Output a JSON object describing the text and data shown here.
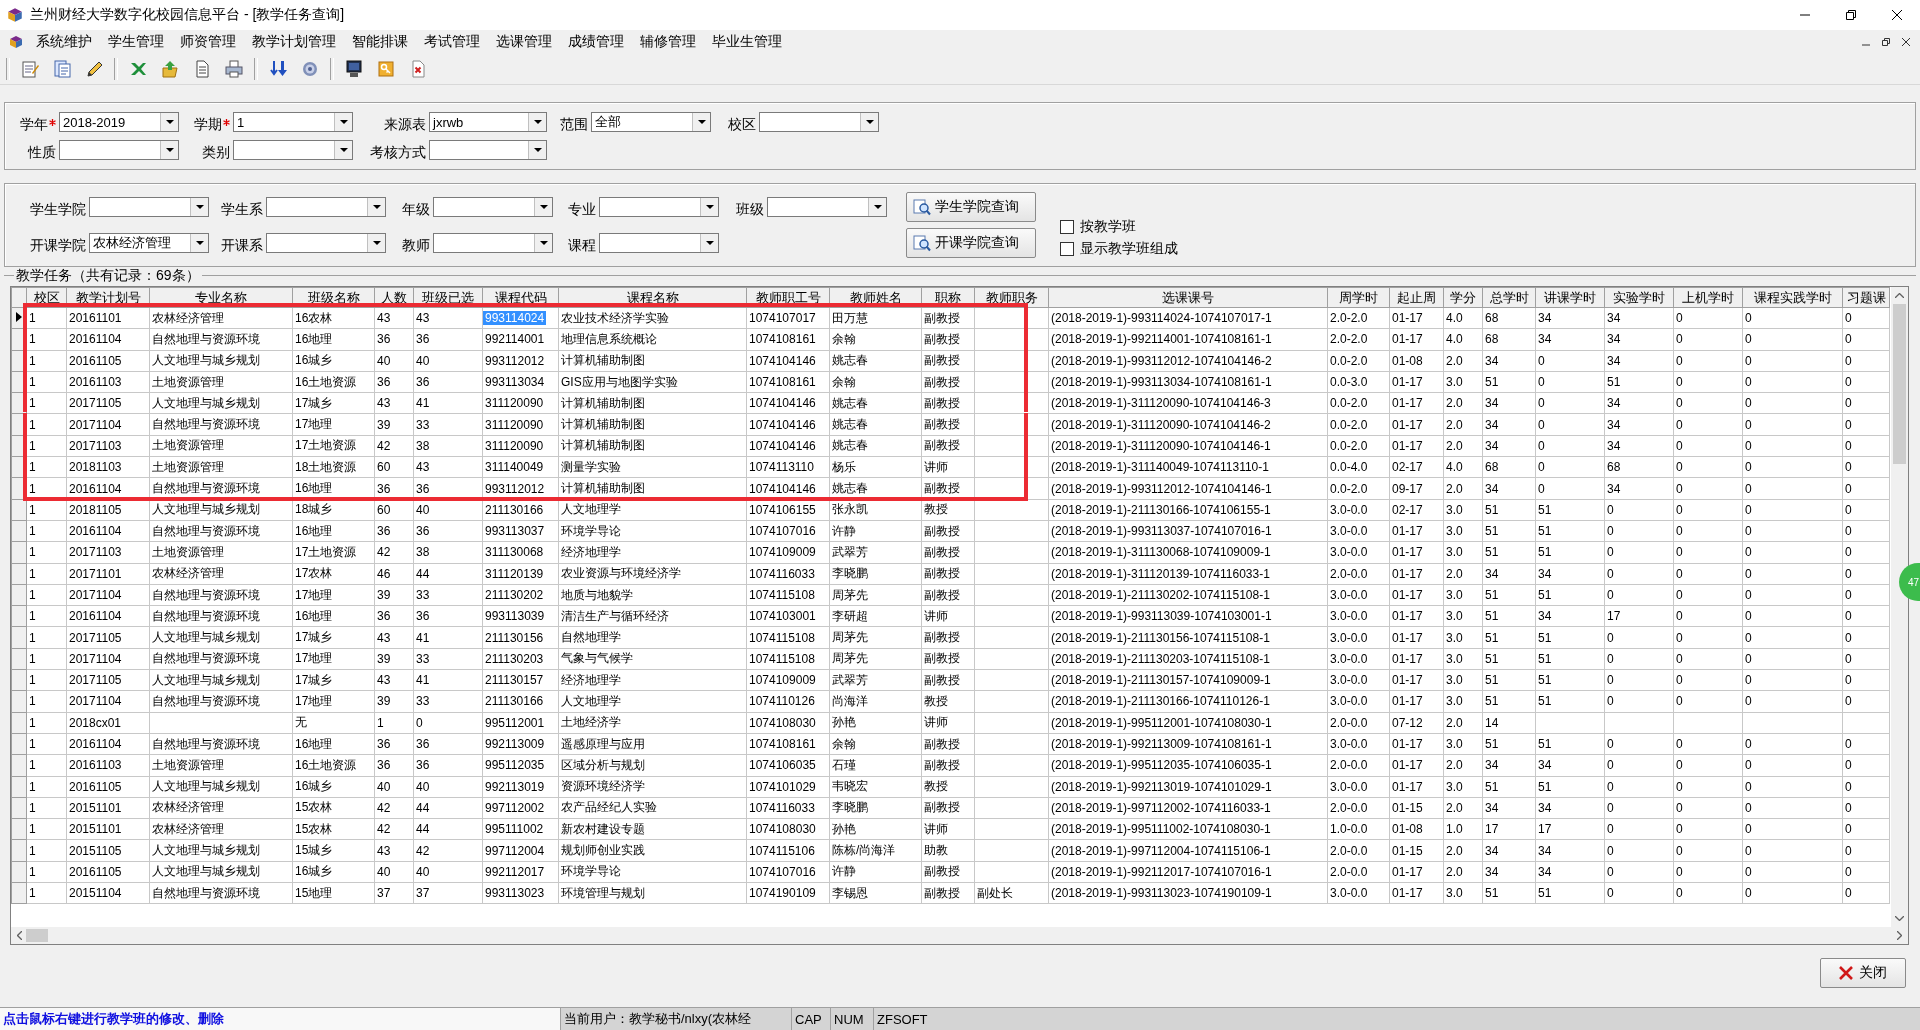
{
  "window": {
    "title": "兰州财经大学数字化校园信息平台 - [教学任务查询]"
  },
  "menu": [
    "系统维护",
    "学生管理",
    "师资管理",
    "教学计划管理",
    "智能排课",
    "考试管理",
    "选课管理",
    "成绩管理",
    "辅修管理",
    "毕业生管理"
  ],
  "query_panel": {
    "rows": [
      [
        {
          "label": "学年",
          "required": true,
          "value": "2018-2019"
        },
        {
          "label": "学期",
          "required": true,
          "value": "1"
        },
        {
          "label": "来源表",
          "required": false,
          "value": "jxrwb"
        },
        {
          "label": "范围",
          "required": false,
          "value": "全部"
        },
        {
          "label": "校区",
          "required": false
        }
      ],
      [
        {
          "label": "性质",
          "required": false
        },
        {
          "label": "类别",
          "required": false
        },
        {
          "label": "考核方式",
          "required": false
        }
      ]
    ]
  },
  "class_panel": {
    "rows": [
      {
        "fields": [
          {
            "label": "学生学院"
          },
          {
            "label": "学生系"
          },
          {
            "label": "年级"
          },
          {
            "label": "专业"
          },
          {
            "label": "班级"
          }
        ],
        "button": "学生学院查询"
      },
      {
        "fields": [
          {
            "label": "开课学院",
            "value": "农林经济管理"
          },
          {
            "label": "开课系"
          },
          {
            "label": "教师"
          },
          {
            "label": "课程"
          }
        ],
        "button": "开课学院查询"
      }
    ],
    "checkboxes": [
      {
        "label": "按教学班",
        "checked": false
      },
      {
        "label": "显示教学班组成",
        "checked": false
      }
    ]
  },
  "table": {
    "caption": "教学任务（共有记录：69条）",
    "columns": [
      {
        "label": "校区",
        "focused": false
      },
      {
        "label": "教学计划号",
        "focused": false
      },
      {
        "label": "专业名称",
        "focused": false
      },
      {
        "label": "班级名称",
        "focused": false
      },
      {
        "label": "人数",
        "focused": false
      },
      {
        "label": "班级已选",
        "focused": false
      },
      {
        "label": "课程代码",
        "focused": true
      },
      {
        "label": "课程名称",
        "focused": false
      },
      {
        "label": "教师职工号",
        "focused": false
      },
      {
        "label": "教师姓名",
        "focused": false
      },
      {
        "label": "职称",
        "focused": false
      },
      {
        "label": "教师职务",
        "focused": false
      },
      {
        "label": "选课课号",
        "focused": false
      },
      {
        "label": "周学时",
        "focused": false
      },
      {
        "label": "起止周",
        "focused": false
      },
      {
        "label": "学分",
        "focused": false
      },
      {
        "label": "总学时",
        "focused": false
      },
      {
        "label": "讲课学时",
        "focused": false
      },
      {
        "label": "实验学时",
        "focused": false
      },
      {
        "label": "上机学时",
        "focused": false
      },
      {
        "label": "课程实践学时",
        "focused": false
      },
      {
        "label": "习题课",
        "focused": false
      }
    ],
    "rows": [
      {
        "current": true,
        "marked": true,
        "cells": [
          "1",
          "20161101",
          "农林经济管理",
          "16农林",
          "43",
          "43",
          "993114024",
          "农业技术经济学实验",
          "1074107017",
          "田万慧",
          "副教授",
          null,
          "(2018-2019-1)-993114024-1074107017-1",
          "2.0-2.0",
          "01-17",
          "4.0",
          "68",
          "34",
          "34",
          "0",
          "0",
          "0"
        ]
      },
      {
        "current": false,
        "marked": true,
        "cells": [
          "1",
          "20161104",
          "自然地理与资源环境",
          "16地理",
          "36",
          "36",
          "992114001",
          "地理信息系统概论",
          "1074108161",
          "余翰",
          "副教授",
          null,
          "(2018-2019-1)-992114001-1074108161-1",
          "2.0-2.0",
          "01-17",
          "4.0",
          "68",
          "34",
          "34",
          "0",
          "0",
          "0"
        ]
      },
      {
        "current": false,
        "marked": true,
        "cells": [
          "1",
          "20161105",
          "人文地理与城乡规划",
          "16城乡",
          "40",
          "40",
          "993112012",
          "计算机辅助制图",
          "1074104146",
          "姚志春",
          "副教授",
          null,
          "(2018-2019-1)-993112012-1074104146-2",
          "0.0-2.0",
          "01-08",
          "2.0",
          "34",
          "0",
          "34",
          "0",
          "0",
          "0"
        ]
      },
      {
        "current": false,
        "marked": true,
        "cells": [
          "1",
          "20161103",
          "土地资源管理",
          "16土地资源",
          "36",
          "36",
          "993113034",
          "GIS应用与地图学实验",
          "1074108161",
          "余翰",
          "副教授",
          null,
          "(2018-2019-1)-993113034-1074108161-1",
          "0.0-3.0",
          "01-17",
          "3.0",
          "51",
          "0",
          "51",
          "0",
          "0",
          "0"
        ]
      },
      {
        "current": false,
        "marked": true,
        "cells": [
          "1",
          "20171105",
          "人文地理与城乡规划",
          "17城乡",
          "43",
          "41",
          "311120090",
          "计算机辅助制图",
          "1074104146",
          "姚志春",
          "副教授",
          null,
          "(2018-2019-1)-311120090-1074104146-3",
          "0.0-2.0",
          "01-17",
          "2.0",
          "34",
          "0",
          "34",
          "0",
          "0",
          "0"
        ]
      },
      {
        "current": false,
        "marked": true,
        "cells": [
          "1",
          "20171104",
          "自然地理与资源环境",
          "17地理",
          "39",
          "33",
          "311120090",
          "计算机辅助制图",
          "1074104146",
          "姚志春",
          "副教授",
          null,
          "(2018-2019-1)-311120090-1074104146-2",
          "0.0-2.0",
          "01-17",
          "2.0",
          "34",
          "0",
          "34",
          "0",
          "0",
          "0"
        ]
      },
      {
        "current": false,
        "marked": true,
        "cells": [
          "1",
          "20171103",
          "土地资源管理",
          "17土地资源",
          "42",
          "38",
          "311120090",
          "计算机辅助制图",
          "1074104146",
          "姚志春",
          "副教授",
          null,
          "(2018-2019-1)-311120090-1074104146-1",
          "0.0-2.0",
          "01-17",
          "2.0",
          "34",
          "0",
          "34",
          "0",
          "0",
          "0"
        ]
      },
      {
        "current": false,
        "marked": true,
        "cells": [
          "1",
          "20181103",
          "土地资源管理",
          "18土地资源",
          "60",
          "43",
          "311140049",
          "测量学实验",
          "1074113110",
          "杨乐",
          "讲师",
          null,
          "(2018-2019-1)-311140049-1074113110-1",
          "0.0-4.0",
          "02-17",
          "4.0",
          "68",
          "0",
          "68",
          "0",
          "0",
          "0"
        ]
      },
      {
        "current": false,
        "marked": true,
        "cells": [
          "1",
          "20161104",
          "自然地理与资源环境",
          "16地理",
          "36",
          "36",
          "993112012",
          "计算机辅助制图",
          "1074104146",
          "姚志春",
          "副教授",
          null,
          "(2018-2019-1)-993112012-1074104146-1",
          "0.0-2.0",
          "09-17",
          "2.0",
          "34",
          "0",
          "34",
          "0",
          "0",
          "0"
        ]
      },
      {
        "current": false,
        "marked": false,
        "cells": [
          "1",
          "20181105",
          "人文地理与城乡规划",
          "18城乡",
          "60",
          "40",
          "211130166",
          "人文地理学",
          "1074106155",
          "张永凯",
          "教授",
          null,
          "(2018-2019-1)-211130166-1074106155-1",
          "3.0-0.0",
          "02-17",
          "3.0",
          "51",
          "51",
          "0",
          "0",
          "0",
          "0"
        ]
      },
      {
        "current": false,
        "marked": false,
        "cells": [
          "1",
          "20161104",
          "自然地理与资源环境",
          "16地理",
          "36",
          "36",
          "993113037",
          "环境学导论",
          "1074107016",
          "许静",
          "副教授",
          null,
          "(2018-2019-1)-993113037-1074107016-1",
          "3.0-0.0",
          "01-17",
          "3.0",
          "51",
          "51",
          "0",
          "0",
          "0",
          "0"
        ]
      },
      {
        "current": false,
        "marked": false,
        "cells": [
          "1",
          "20171103",
          "土地资源管理",
          "17土地资源",
          "42",
          "38",
          "311130068",
          "经济地理学",
          "1074109009",
          "武翠芳",
          "副教授",
          null,
          "(2018-2019-1)-311130068-1074109009-1",
          "3.0-0.0",
          "01-17",
          "3.0",
          "51",
          "51",
          "0",
          "0",
          "0",
          "0"
        ]
      },
      {
        "current": false,
        "marked": false,
        "cells": [
          "1",
          "20171101",
          "农林经济管理",
          "17农林",
          "46",
          "44",
          "311120139",
          "农业资源与环境经济学",
          "1074116033",
          "李晓鹏",
          "副教授",
          null,
          "(2018-2019-1)-311120139-1074116033-1",
          "2.0-0.0",
          "01-17",
          "2.0",
          "34",
          "34",
          "0",
          "0",
          "0",
          "0"
        ]
      },
      {
        "current": false,
        "marked": false,
        "cells": [
          "1",
          "20171104",
          "自然地理与资源环境",
          "17地理",
          "39",
          "33",
          "211130202",
          "地质与地貌学",
          "1074115108",
          "周茅先",
          "副教授",
          null,
          "(2018-2019-1)-211130202-1074115108-1",
          "3.0-0.0",
          "01-17",
          "3.0",
          "51",
          "51",
          "0",
          "0",
          "0",
          "0"
        ]
      },
      {
        "current": false,
        "marked": false,
        "cells": [
          "1",
          "20161104",
          "自然地理与资源环境",
          "16地理",
          "36",
          "36",
          "993113039",
          "清洁生产与循环经济",
          "1074103001",
          "李研超",
          "讲师",
          null,
          "(2018-2019-1)-993113039-1074103001-1",
          "3.0-0.0",
          "01-17",
          "3.0",
          "51",
          "34",
          "17",
          "0",
          "0",
          "0"
        ]
      },
      {
        "current": false,
        "marked": false,
        "cells": [
          "1",
          "20171105",
          "人文地理与城乡规划",
          "17城乡",
          "43",
          "41",
          "211130156",
          "自然地理学",
          "1074115108",
          "周茅先",
          "副教授",
          null,
          "(2018-2019-1)-211130156-1074115108-1",
          "3.0-0.0",
          "01-17",
          "3.0",
          "51",
          "51",
          "0",
          "0",
          "0",
          "0"
        ]
      },
      {
        "current": false,
        "marked": false,
        "cells": [
          "1",
          "20171104",
          "自然地理与资源环境",
          "17地理",
          "39",
          "33",
          "211130203",
          "气象与气候学",
          "1074115108",
          "周茅先",
          "副教授",
          null,
          "(2018-2019-1)-211130203-1074115108-1",
          "3.0-0.0",
          "01-17",
          "3.0",
          "51",
          "51",
          "0",
          "0",
          "0",
          "0"
        ]
      },
      {
        "current": false,
        "marked": false,
        "cells": [
          "1",
          "20171105",
          "人文地理与城乡规划",
          "17城乡",
          "43",
          "41",
          "211130157",
          "经济地理学",
          "1074109009",
          "武翠芳",
          "副教授",
          null,
          "(2018-2019-1)-211130157-1074109009-1",
          "3.0-0.0",
          "01-17",
          "3.0",
          "51",
          "51",
          "0",
          "0",
          "0",
          "0"
        ]
      },
      {
        "current": false,
        "marked": false,
        "cells": [
          "1",
          "20171104",
          "自然地理与资源环境",
          "17地理",
          "39",
          "33",
          "211130166",
          "人文地理学",
          "1074110126",
          "尚海洋",
          "教授",
          null,
          "(2018-2019-1)-211130166-1074110126-1",
          "3.0-0.0",
          "01-17",
          "3.0",
          "51",
          "51",
          "0",
          "0",
          "0",
          "0"
        ]
      },
      {
        "current": false,
        "marked": false,
        "cells": [
          "1",
          "2018cx01",
          null,
          "无",
          "1",
          "0",
          "995112001",
          "土地经济学",
          "1074108030",
          "孙艳",
          "讲师",
          null,
          "(2018-2019-1)-995112001-1074108030-1",
          "2.0-0.0",
          "07-12",
          "2.0",
          "14",
          null,
          null,
          null,
          null,
          null
        ]
      },
      {
        "current": false,
        "marked": false,
        "cells": [
          "1",
          "20161104",
          "自然地理与资源环境",
          "16地理",
          "36",
          "36",
          "992113009",
          "遥感原理与应用",
          "1074108161",
          "余翰",
          "副教授",
          null,
          "(2018-2019-1)-992113009-1074108161-1",
          "3.0-0.0",
          "01-17",
          "3.0",
          "51",
          "51",
          "0",
          "0",
          "0",
          "0"
        ]
      },
      {
        "current": false,
        "marked": false,
        "cells": [
          "1",
          "20161103",
          "土地资源管理",
          "16土地资源",
          "36",
          "36",
          "995112035",
          "区域分析与规划",
          "1074106035",
          "石瑾",
          "副教授",
          null,
          "(2018-2019-1)-995112035-1074106035-1",
          "2.0-0.0",
          "01-17",
          "2.0",
          "34",
          "34",
          "0",
          "0",
          "0",
          "0"
        ]
      },
      {
        "current": false,
        "marked": false,
        "cells": [
          "1",
          "20161105",
          "人文地理与城乡规划",
          "16城乡",
          "40",
          "40",
          "992113019",
          "资源环境经济学",
          "1074101029",
          "韦晓宏",
          "教授",
          null,
          "(2018-2019-1)-992113019-1074101029-1",
          "3.0-0.0",
          "01-17",
          "3.0",
          "51",
          "51",
          "0",
          "0",
          "0",
          "0"
        ]
      },
      {
        "current": false,
        "marked": false,
        "cells": [
          "1",
          "20151101",
          "农林经济管理",
          "15农林",
          "42",
          "44",
          "997112002",
          "农产品经纪人实验",
          "1074116033",
          "李晓鹏",
          "副教授",
          null,
          "(2018-2019-1)-997112002-1074116033-1",
          "2.0-0.0",
          "01-15",
          "2.0",
          "34",
          "34",
          "0",
          "0",
          "0",
          "0"
        ]
      },
      {
        "current": false,
        "marked": false,
        "cells": [
          "1",
          "20151101",
          "农林经济管理",
          "15农林",
          "42",
          "44",
          "995111002",
          "新农村建设专题",
          "1074108030",
          "孙艳",
          "讲师",
          null,
          "(2018-2019-1)-995111002-1074108030-1",
          "1.0-0.0",
          "01-08",
          "1.0",
          "17",
          "17",
          "0",
          "0",
          "0",
          "0"
        ]
      },
      {
        "current": false,
        "marked": false,
        "cells": [
          "1",
          "20151105",
          "人文地理与城乡规划",
          "15城乡",
          "43",
          "42",
          "997112004",
          "规划师创业实践",
          "1074115106",
          "陈栋/尚海洋",
          "助教",
          null,
          "(2018-2019-1)-997112004-1074115106-1",
          "2.0-0.0",
          "01-15",
          "2.0",
          "34",
          "34",
          "0",
          "0",
          "0",
          "0"
        ]
      },
      {
        "current": false,
        "marked": false,
        "cells": [
          "1",
          "20161105",
          "人文地理与城乡规划",
          "16城乡",
          "40",
          "40",
          "992112017",
          "环境学导论",
          "1074107016",
          "许静",
          "副教授",
          null,
          "(2018-2019-1)-992112017-1074107016-1",
          "2.0-0.0",
          "01-17",
          "2.0",
          "34",
          "34",
          "0",
          "0",
          "0",
          "0"
        ]
      },
      {
        "current": false,
        "marked": false,
        "cells": [
          "1",
          "20151104",
          "自然地理与资源环境",
          "15地理",
          "37",
          "37",
          "993113023",
          "环境管理与规划",
          "1074190109",
          "李锡恩",
          "副教授",
          "副处长",
          "(2018-2019-1)-993113023-1074190109-1",
          "3.0-0.0",
          "01-17",
          "3.0",
          "51",
          "51",
          "0",
          "0",
          "0",
          "0"
        ]
      }
    ]
  },
  "floating_badge": "47",
  "close_button": "关闭",
  "status_bar": {
    "hint": "点击鼠标右键进行教学班的修改、删除",
    "user": "当前用户：教学秘书/nlxy(农林经",
    "caps": "CAP",
    "num": "NUM",
    "vendor": "ZFSOFT"
  }
}
